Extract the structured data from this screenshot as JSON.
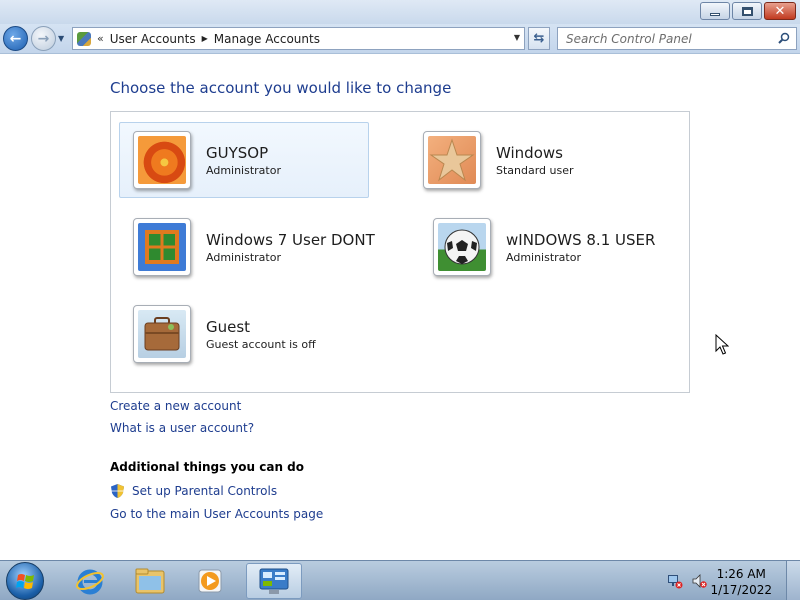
{
  "window": {
    "minimize_icon": "minimize-icon",
    "maximize_icon": "restore-icon",
    "close_icon": "close-icon"
  },
  "navigation": {
    "back_icon": "back-arrow-icon",
    "forward_icon": "forward-arrow-icon",
    "address": {
      "chevron": "«",
      "crumbs": [
        "User Accounts",
        "Manage Accounts"
      ]
    },
    "refresh_icon": "refresh-icon",
    "search": {
      "placeholder": "Search Control Panel",
      "icon": "search-icon"
    }
  },
  "main": {
    "title": "Choose the account you would like to change",
    "accounts": [
      {
        "name": "GUYSOP",
        "role": "Administrator",
        "picture": "orange-flower",
        "selected": true
      },
      {
        "name": "Windows",
        "role": "Standard user",
        "picture": "starfish"
      },
      {
        "name": "Windows 7 User DONT",
        "role": "Administrator",
        "picture": "green-window-grid"
      },
      {
        "name": "wINDOWS 8.1 USER",
        "role": "Administrator",
        "picture": "soccer-ball"
      },
      {
        "name": "Guest",
        "role": "Guest account is off",
        "picture": "briefcase"
      }
    ],
    "links": {
      "create_account": "Create a new account",
      "what_is_account": "What is a user account?"
    },
    "additional": {
      "heading": "Additional things you can do",
      "parental_controls": "Set up Parental Controls",
      "main_page": "Go to the main User Accounts page"
    }
  },
  "taskbar": {
    "pinned": [
      "internet-explorer-icon",
      "windows-explorer-icon",
      "media-player-icon",
      "control-panel-icon"
    ],
    "active_item": "control-panel-icon",
    "clock": {
      "time": "1:26 AM",
      "date": "1/17/2022"
    }
  },
  "colors": {
    "link": "#1e3d8f",
    "selected_bg": "#e6f0fb",
    "taskbar": "#a9bfd8"
  }
}
